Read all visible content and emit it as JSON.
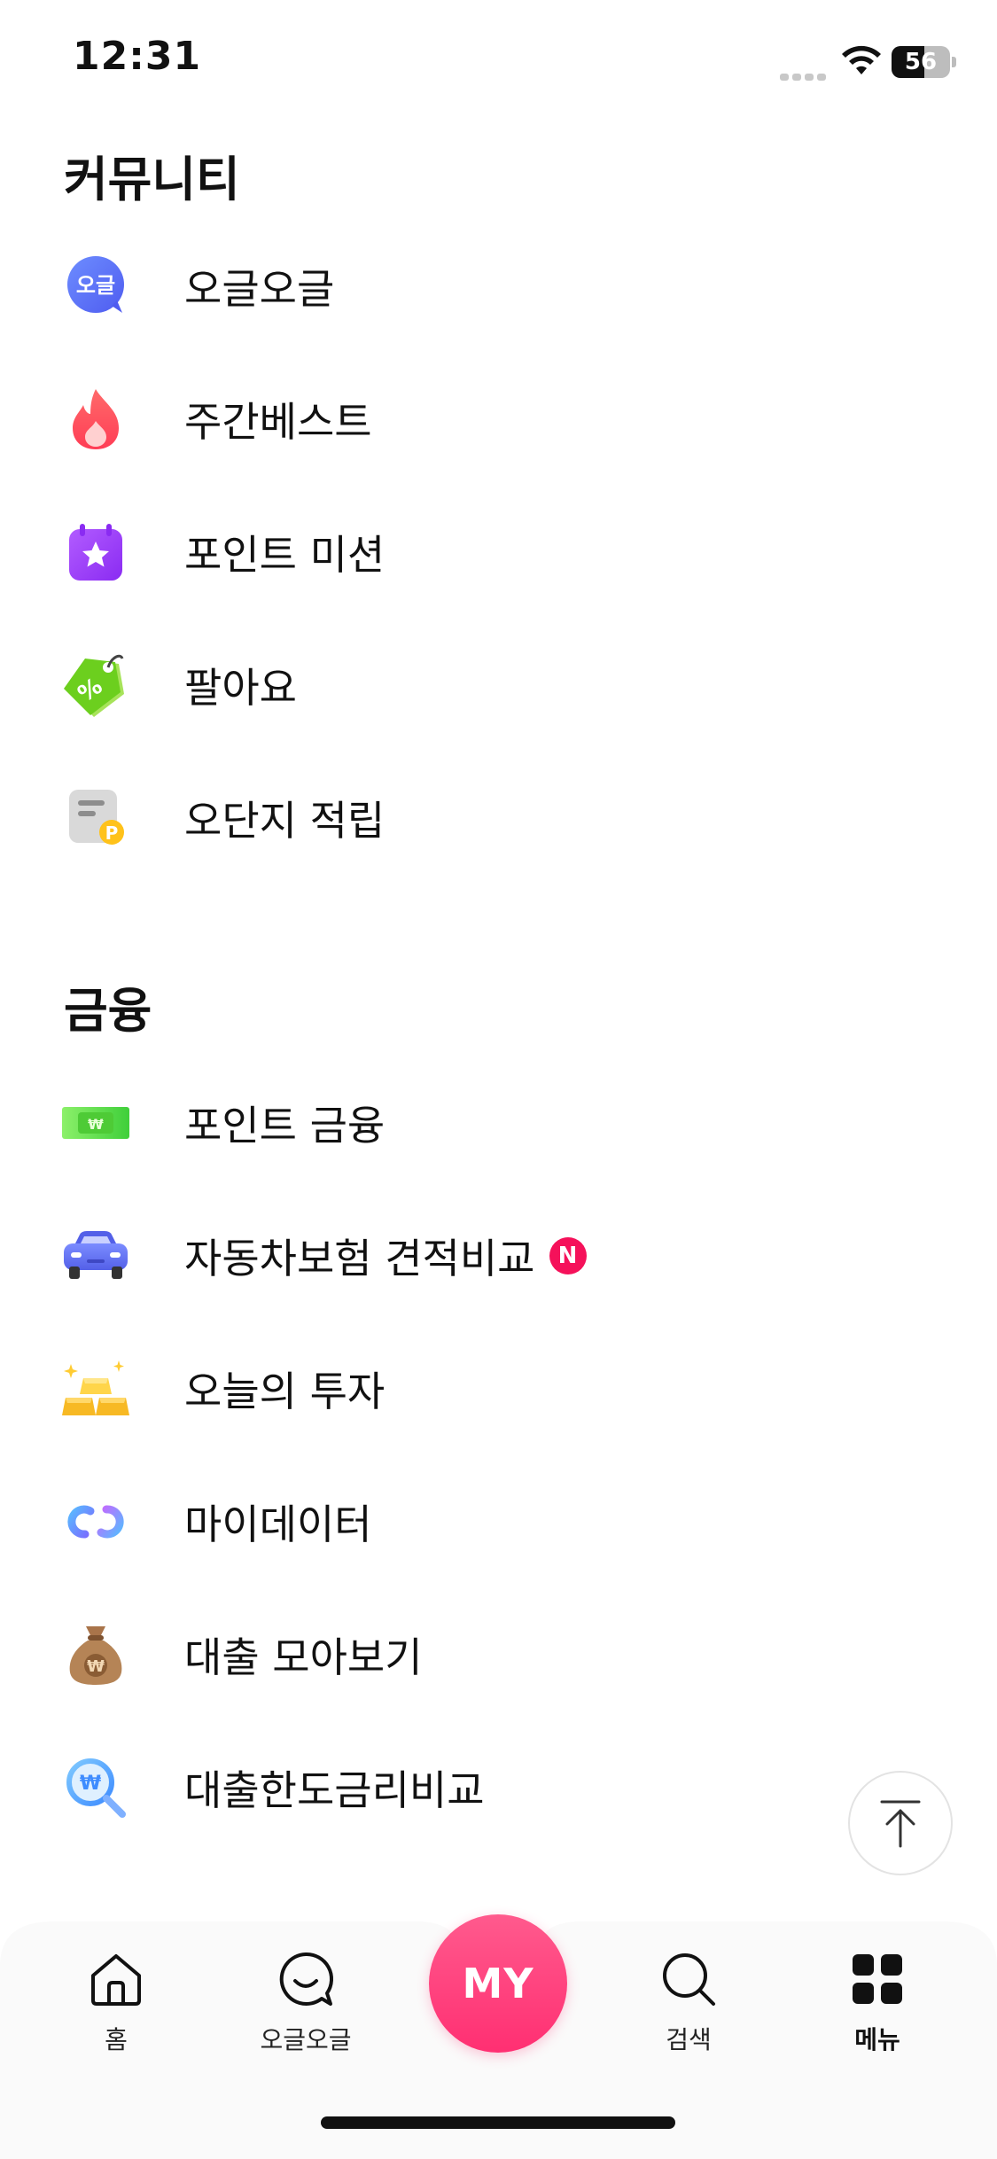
{
  "status_bar": {
    "time": "12:31",
    "battery": "56",
    "battery_level": 0.56
  },
  "community": {
    "title": "커뮤니티",
    "items": [
      {
        "label": "오글오글",
        "icon": "oguloggul-chat-icon",
        "icon_text": "오글"
      },
      {
        "label": "주간베스트",
        "icon": "fire-icon"
      },
      {
        "label": "포인트 미션",
        "icon": "calendar-star-icon"
      },
      {
        "label": "팔아요",
        "icon": "price-tag-icon"
      },
      {
        "label": "오단지 적립",
        "icon": "receipt-point-icon",
        "icon_text": "P"
      }
    ]
  },
  "finance": {
    "title": "금융",
    "items": [
      {
        "label": "포인트 금융",
        "icon": "cash-bill-icon",
        "icon_text": "₩"
      },
      {
        "label": "자동차보험 견적비교",
        "icon": "car-icon",
        "badge": "N"
      },
      {
        "label": "오늘의 투자",
        "icon": "gold-bars-icon"
      },
      {
        "label": "마이데이터",
        "icon": "link-chain-icon"
      },
      {
        "label": "대출 모아보기",
        "icon": "money-bag-icon",
        "icon_text": "₩"
      },
      {
        "label": "대출한도금리비교",
        "icon": "magnifier-won-icon",
        "icon_text": "₩"
      }
    ]
  },
  "bottom_nav": {
    "home": "홈",
    "community": "오글오글",
    "my": "MY",
    "search": "검색",
    "menu": "메뉴"
  },
  "colors": {
    "brand_pink": "#ff2f72",
    "badge_red": "#f5115a"
  }
}
